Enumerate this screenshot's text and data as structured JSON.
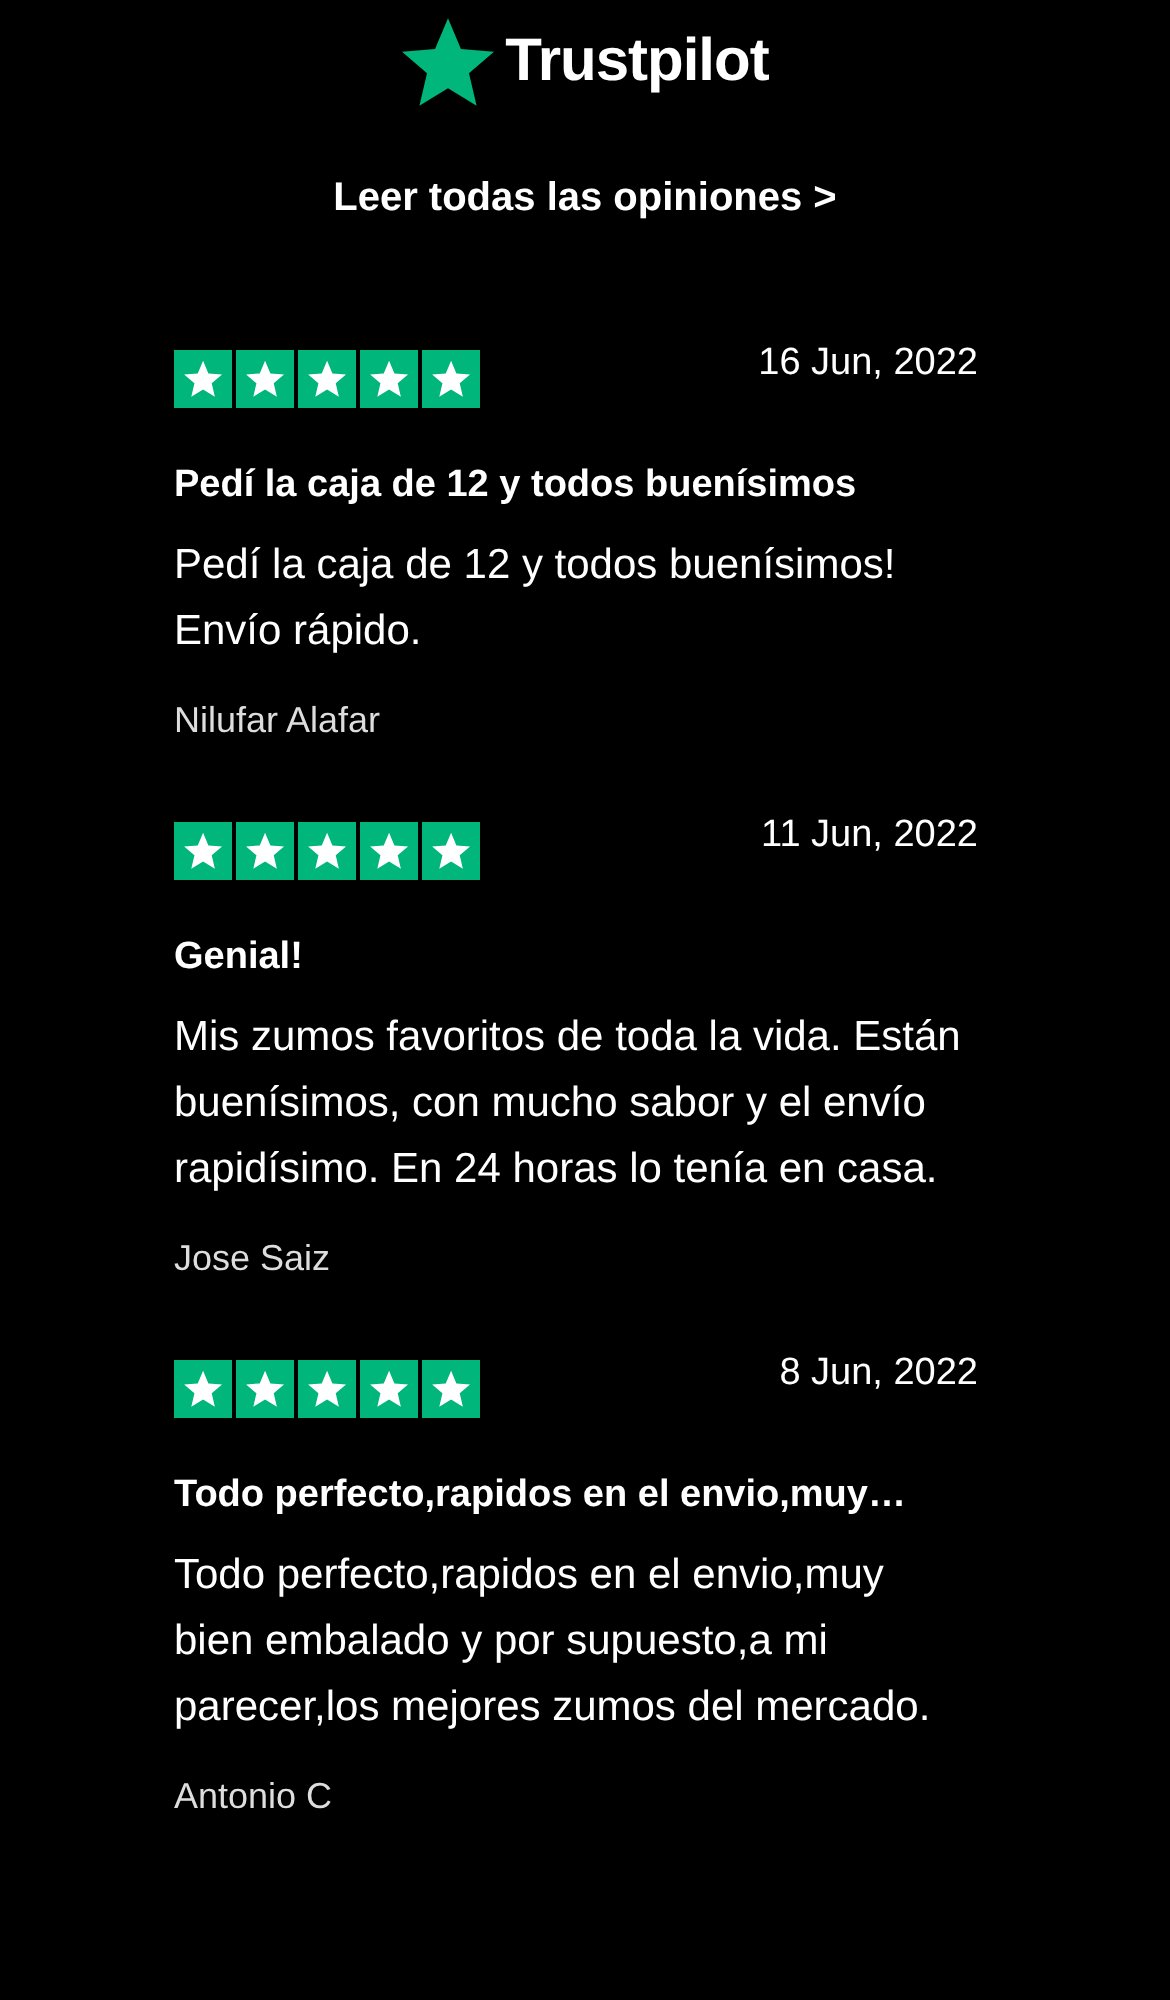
{
  "logo": {
    "text": "Trustpilot"
  },
  "read_all_link": "Leer todas las opiniones >",
  "reviews": [
    {
      "stars": 5,
      "date": "16 Jun, 2022",
      "title": "Pedí la caja de 12 y todos buenísimos",
      "body": "Pedí la caja de 12 y todos buenísimos! Envío rápido.",
      "author": "Nilufar Alafar"
    },
    {
      "stars": 5,
      "date": "11 Jun, 2022",
      "title": "Genial!",
      "body": "Mis zumos favoritos de toda la vida. Están buenísimos, con mucho sabor y el envío rapidísimo. En 24 horas lo tenía en casa.",
      "author": "Jose Saiz"
    },
    {
      "stars": 5,
      "date": "8 Jun, 2022",
      "title": "Todo perfecto,rapidos en el envio,muy…",
      "body": "Todo perfecto,rapidos en el envio,muy bien embalado y por supuesto,a mi parecer,los mejores zumos del mercado.",
      "author": "Antonio C"
    }
  ]
}
